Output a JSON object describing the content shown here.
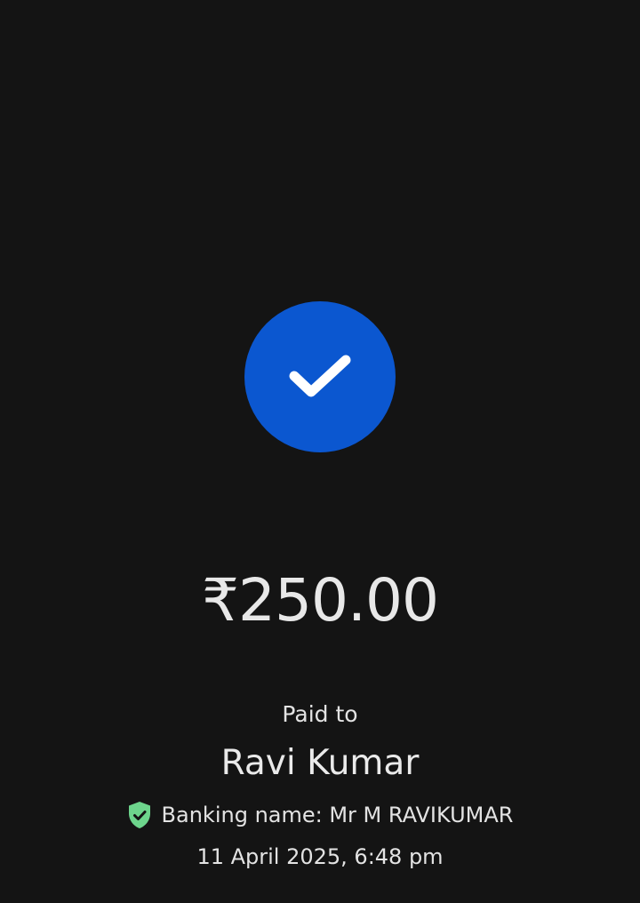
{
  "icons": {
    "success": "checkmark-icon",
    "verified": "verified-shield-icon"
  },
  "colors": {
    "background": "#141414",
    "success_circle": "#0b57d0",
    "checkmark": "#ffffff",
    "verified_shield": "#6dd58c",
    "text": "#e3e3e3"
  },
  "payment": {
    "amount": "₹250.00",
    "paid_to_label": "Paid to",
    "payee_name": "Ravi Kumar",
    "banking_name": "Banking name: Mr M RAVIKUMAR",
    "timestamp": "11 April 2025, 6:48 pm"
  }
}
